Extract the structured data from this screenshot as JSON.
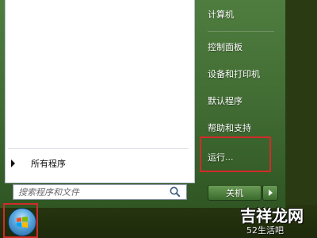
{
  "start_menu": {
    "all_programs_label": "所有程序",
    "search_placeholder": "搜索程序和文件",
    "right_items": [
      {
        "label": "计算机"
      },
      {
        "label": "控制面板"
      },
      {
        "label": "设备和打印机"
      },
      {
        "label": "默认程序"
      },
      {
        "label": "帮助和支持"
      },
      {
        "label": "运行..."
      }
    ],
    "shutdown_label": "关机"
  },
  "annotations": {
    "highlight_color": "#d12b2b"
  },
  "watermark": {
    "top": "吉祥龙网",
    "bottom": "52生活吧"
  }
}
